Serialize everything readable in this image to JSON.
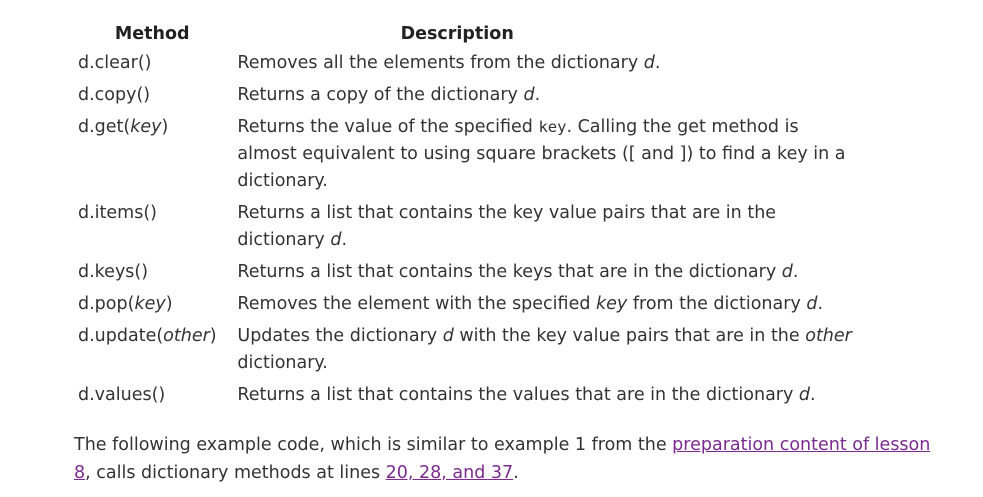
{
  "table": {
    "header_method": "Method",
    "header_description": "Description",
    "rows": [
      {
        "method_prefix": "d.clear()",
        "method_arg": "",
        "method_suffix": "",
        "desc_parts": [
          "Removes all the elements from the dictionary ",
          "d",
          "."
        ]
      },
      {
        "method_prefix": "d.copy()",
        "method_arg": "",
        "method_suffix": "",
        "desc_parts": [
          "Returns a copy of the dictionary ",
          "d",
          "."
        ]
      },
      {
        "method_prefix": "d.get(",
        "method_arg": "key",
        "method_suffix": ")",
        "desc_parts": [
          "Returns the value of the specified ",
          "key",
          ". Calling the get method is almost equivalent to using square brackets ([ and ]) to find a key in a dictionary."
        ]
      },
      {
        "method_prefix": "d.items()",
        "method_arg": "",
        "method_suffix": "",
        "desc_parts": [
          "Returns a list that contains the key value pairs that are in the dictionary ",
          "d",
          "."
        ]
      },
      {
        "method_prefix": "d.keys()",
        "method_arg": "",
        "method_suffix": "",
        "desc_parts": [
          "Returns a list that contains the keys that are in the dictionary ",
          "d",
          "."
        ]
      },
      {
        "method_prefix": "d.pop(",
        "method_arg": "key",
        "method_suffix": ")",
        "desc_parts": [
          "Removes the element with the specified ",
          "key",
          " from the dictionary ",
          "d",
          "."
        ]
      },
      {
        "method_prefix": "d.update(",
        "method_arg": "other",
        "method_suffix": ")",
        "desc_parts": [
          "Updates the dictionary ",
          "d",
          " with the key value pairs that are in the ",
          "other",
          " dictionary."
        ]
      },
      {
        "method_prefix": "d.values()",
        "method_arg": "",
        "method_suffix": "",
        "desc_parts": [
          "Returns a list that contains the values that are in the dictionary ",
          "d",
          "."
        ]
      }
    ]
  },
  "paragraph": {
    "text_before": "The following example code, which is similar to example 1 from the ",
    "link_text": "preparation content of lesson 8",
    "text_middle": ", calls dictionary methods at lines ",
    "lines_link": "20, 28, and 37",
    "text_after": "."
  }
}
